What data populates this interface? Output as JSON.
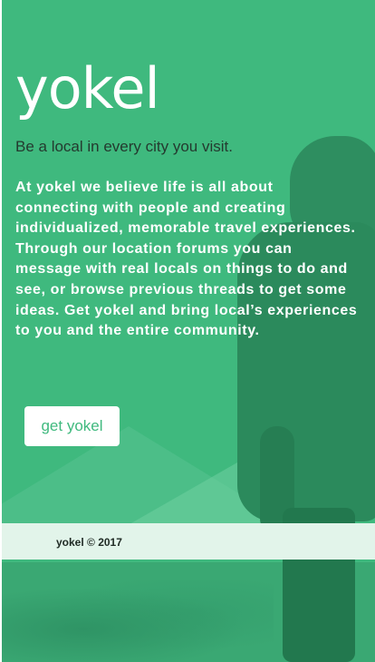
{
  "brand": {
    "name": "yokel",
    "tagline": "Be a local in every city you visit.",
    "accent_color": "#3fb97e"
  },
  "hero": {
    "description": "At yokel we believe life is all about connecting with people and creating individualized, memorable travel experiences. Through our location forums you can message with real locals on things to do and see, or browse previous threads to get some ideas. Get yokel and bring local’s experiences to you and the entire community.",
    "cta_label": "get yokel"
  },
  "footer": {
    "copyright": "yokel © 2017"
  }
}
